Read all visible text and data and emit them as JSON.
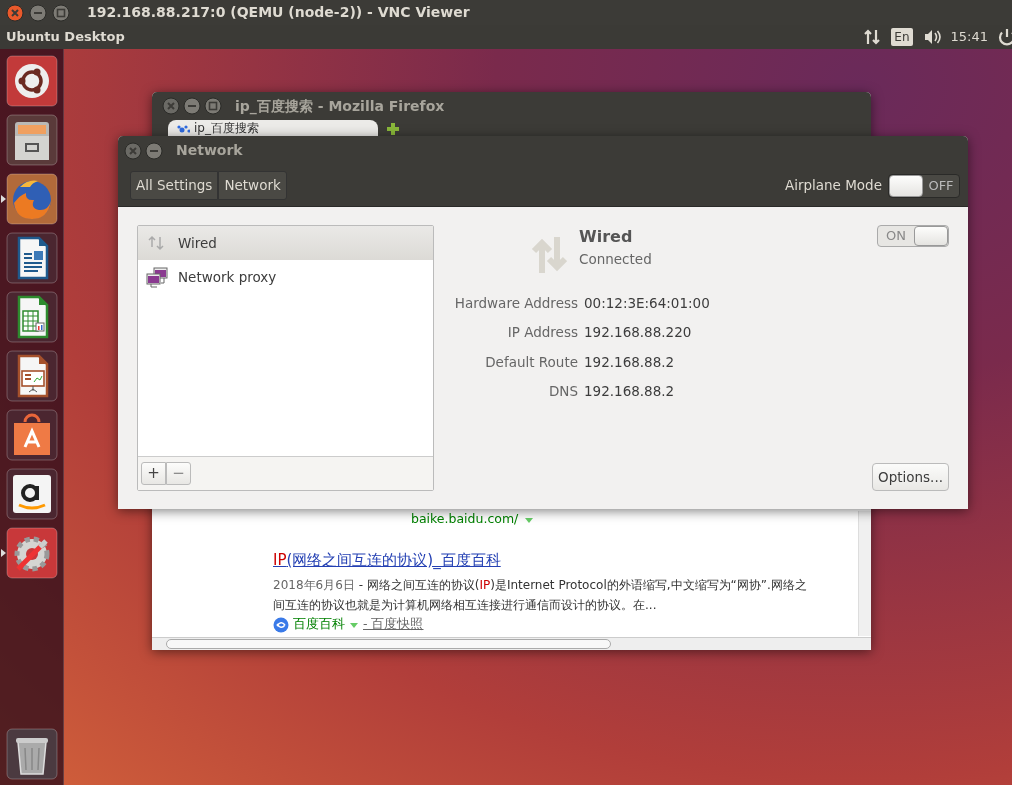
{
  "vnc_window": {
    "title": "192.168.88.217:0 (QEMU (node-2)) - VNC Viewer"
  },
  "top_panel": {
    "title": "Ubuntu Desktop",
    "keyboard_layout": "En",
    "clock": "15:41"
  },
  "launcher": {
    "items": [
      {
        "kind": "dash",
        "running": false
      },
      {
        "kind": "files",
        "running": false
      },
      {
        "kind": "browser",
        "running": true
      },
      {
        "kind": "writer",
        "running": false
      },
      {
        "kind": "calc",
        "running": false
      },
      {
        "kind": "impress",
        "running": false
      },
      {
        "kind": "store",
        "running": false
      },
      {
        "kind": "amazon",
        "running": false
      },
      {
        "kind": "settings",
        "running": true
      },
      {
        "kind": "trash",
        "running": false
      }
    ]
  },
  "firefox": {
    "title": "ip_百度搜索 - Mozilla Firefox",
    "tabs": [
      {
        "label": "ip_百度搜索",
        "selected": true
      }
    ],
    "result_url": "baike.baidu.com/",
    "result": {
      "title_highlight": "IP",
      "title_rest": "(网络之间互连的协议)_百度百科",
      "date": "2018年6月6日",
      "snippet_before": " - 网络之间互连的协议(",
      "snippet_highlight": "IP",
      "snippet_after": ")是Internet Protocol的外语缩写,中文缩写为“网协”.网络之间互连的协议也就是为计算机网络相互连接进行通信而设计的协议。在...",
      "source": "百度百科",
      "snapshot": "- 百度快照"
    }
  },
  "network_window": {
    "title": "Network",
    "breadcrumbs": [
      {
        "label": "All Settings"
      },
      {
        "label": "Network"
      }
    ],
    "airplane_mode": {
      "label": "Airplane Mode",
      "on": false,
      "switch_text": "OFF"
    },
    "devices": [
      {
        "kind": "wired",
        "label": "Wired",
        "selected": true
      },
      {
        "kind": "proxy",
        "label": "Network proxy",
        "selected": false
      }
    ],
    "add_button": "+",
    "remove_button": "−",
    "detail": {
      "name": "Wired",
      "status": "Connected",
      "on": true,
      "switch_text": "ON",
      "fields": [
        {
          "label": "Hardware Address",
          "value": "00:12:3E:64:01:00"
        },
        {
          "label": "IP Address",
          "value": "192.168.88.220"
        },
        {
          "label": "Default Route",
          "value": "192.168.88.2"
        },
        {
          "label": "DNS",
          "value": "192.168.88.2"
        }
      ]
    },
    "options_button": "Options..."
  }
}
